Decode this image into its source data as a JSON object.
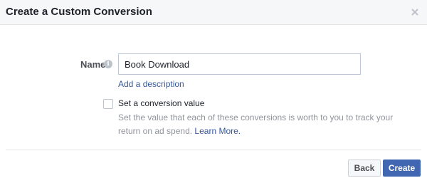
{
  "dialog": {
    "title": "Create a Custom Conversion",
    "close_icon": "close-icon"
  },
  "form": {
    "name_label": "Name",
    "info_icon": "info-icon",
    "info_glyph": "i",
    "name_value": "Book Download",
    "add_description_link": "Add a description",
    "conversion_value_checkbox_label": "Set a conversion value",
    "conversion_value_checked": false,
    "help_text": "Set the value that each of these conversions is worth to you to track your return on ad spend.",
    "learn_more_link": "Learn More."
  },
  "footer": {
    "back_label": "Back",
    "create_label": "Create"
  },
  "colors": {
    "header_bg": "#f6f7f9",
    "link": "#365899",
    "primary_button": "#4267b2"
  }
}
